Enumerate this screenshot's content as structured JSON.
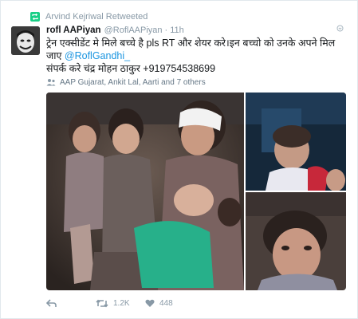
{
  "retweet_context": {
    "text": "Arvind Kejriwal Retweeted"
  },
  "tweet": {
    "display_name": "rofl AAPiyan",
    "handle": "@RoflAAPiyan",
    "separator": "·",
    "time": "11h",
    "text_line1": "ट्रेन एक्सीडेंट मे मिले बच्चे है  pls RT और शेयर करे।इन बच्चो को उनके अपने मिल",
    "text_line2_prefix": "जाए ",
    "mention": "@RoflGandhi_",
    "text_line3": "संपर्क करे चंद्र मोहन ठाकुर +919754538699",
    "tagged_people": "AAP Gujarat, Ankit Lal, Aarti and 7 others"
  },
  "actions": {
    "retweets": "1.2K",
    "likes": "448"
  },
  "colors": {
    "link": "#1b95e0",
    "muted": "#8899a6",
    "retweet_green": "#19cf86"
  },
  "icons": [
    "retweet-icon",
    "chevron-down-icon",
    "person-tag-icon",
    "reply-icon",
    "retweet-action-icon",
    "heart-icon"
  ]
}
